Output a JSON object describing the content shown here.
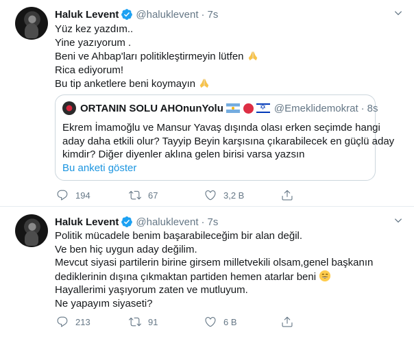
{
  "tweets": [
    {
      "name": "Haluk Levent",
      "handle": "@haluklevent",
      "dot": "·",
      "time": "7s",
      "lines": [
        "Yüz kez yazdım..",
        "Yine yazıyorum .",
        "Beni ve Ahbap'ları politikleştirmeyin lütfen",
        "Rica ediyorum!",
        "Bu tip anketlere beni koymayın"
      ],
      "quote": {
        "name": "ORTANIN SOLU AHOnunYolu",
        "handle": "@Emeklidemokrat",
        "dot": "·",
        "time": "8s",
        "lines": [
          "Ekrem İmamoğlu ve Mansur Yavaş dışında olası erken seçimde hangi",
          "aday daha etkili olur?  Tayyip Beyin karşısına çıkarabilecek en güçlü aday",
          "kimdir? Diğer diyenler aklına gelen birisi varsa yazsın"
        ],
        "link": "Bu anketi göster"
      },
      "actions": {
        "replies": "194",
        "retweets": "67",
        "likes": "3,2 B"
      }
    },
    {
      "name": "Haluk Levent",
      "handle": "@haluklevent",
      "dot": "·",
      "time": "7s",
      "lines": [
        "Politik mücadele benim başarabileceğim bir alan değil.",
        "Ve ben hiç uygun aday değilim.",
        "Mevcut siyasi partilerin birine girsem milletvekili olsam,genel başkanın",
        "dediklerinin dışına çıkmaktan partiden hemen atarlar beni",
        "Hayallerimi yaşıyorum zaten ve mutluyum.",
        "Ne yapayım siyaseti?"
      ],
      "actions": {
        "replies": "213",
        "retweets": "91",
        "likes": "6 B"
      }
    }
  ],
  "colors": {
    "accent": "#1da1f2",
    "text": "#14171a",
    "muted": "#657786",
    "link": "#1b95e0",
    "border": "#ccd6dd"
  },
  "icons": [
    "verified-badge-icon",
    "chevron-down-icon",
    "reply-icon",
    "retweet-icon",
    "like-icon",
    "share-icon",
    "folded-hands-emoji",
    "grinning-emoji",
    "argentina-flag",
    "red-circle",
    "israel-flag"
  ]
}
